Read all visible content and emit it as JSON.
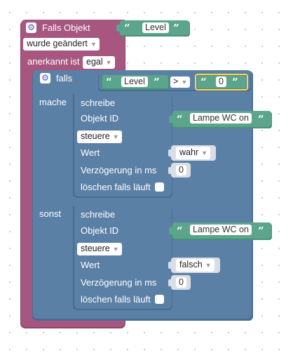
{
  "trigger": {
    "title": "Falls Objekt",
    "object_value": "Level",
    "event_option": "wurde geändert",
    "ack_label": "anerkannt ist",
    "ack_option": "egal"
  },
  "if_block": {
    "label": "falls",
    "left_value": "Level",
    "operator": ">",
    "right_value": "0",
    "then_label": "mache",
    "else_label": "sonst"
  },
  "write_then": {
    "title": "schreibe",
    "object_label": "Objekt ID",
    "object_value": "Lampe WC on",
    "mode": "steuere",
    "value_label": "Wert",
    "value": "wahr",
    "delay_label": "Verzögerung in ms",
    "delay_value": "0",
    "clear_label": "löschen falls läuft"
  },
  "write_else": {
    "title": "schreibe",
    "object_label": "Objekt ID",
    "object_value": "Lampe WC on",
    "mode": "steuere",
    "value_label": "Wert",
    "value": "falsch",
    "delay_label": "Verzögerung in ms",
    "delay_value": "0",
    "clear_label": "löschen falls läuft"
  },
  "colors": {
    "trigger": "#a6567f",
    "logic": "#5b80a5",
    "text": "#5ba58c",
    "gear": "#5a4fcf"
  },
  "icons": [
    "gear-icon",
    "quote-icon",
    "dropdown-caret-icon"
  ]
}
